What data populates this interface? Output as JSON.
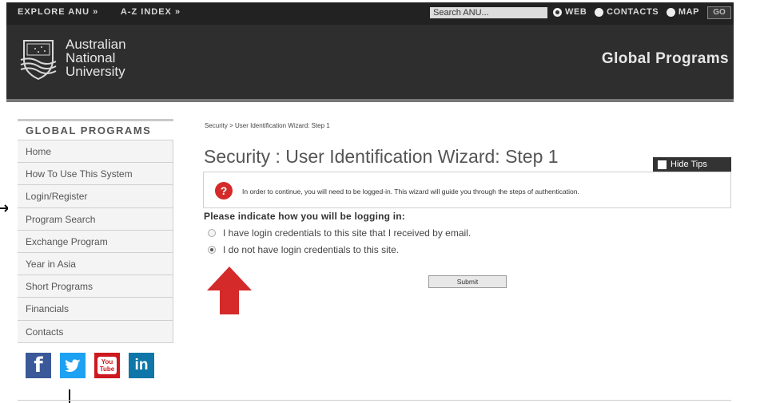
{
  "topbar": {
    "explore_label": "EXPLORE ANU »",
    "az_label": "A-Z INDEX »",
    "search_value": "Search ANU...",
    "options": [
      {
        "label": "WEB",
        "selected": true
      },
      {
        "label": "CONTACTS",
        "selected": false
      },
      {
        "label": "MAP",
        "selected": false
      }
    ],
    "go_label": "GO"
  },
  "header": {
    "logo_lines": [
      "Australian",
      "National",
      "University"
    ],
    "site_title": "Global Programs"
  },
  "sidebar": {
    "title": "GLOBAL PROGRAMS",
    "items": [
      {
        "label": "Home"
      },
      {
        "label": "How To Use This System"
      },
      {
        "label": "Login/Register"
      },
      {
        "label": "Program Search"
      },
      {
        "label": "Exchange Program"
      },
      {
        "label": "Year in Asia"
      },
      {
        "label": "Short Programs"
      },
      {
        "label": "Financials"
      },
      {
        "label": "Contacts"
      }
    ],
    "social": [
      {
        "icon": "facebook-icon",
        "glyph": "f"
      },
      {
        "icon": "twitter-icon",
        "glyph": "🐦"
      },
      {
        "icon": "youtube-icon",
        "glyph": "You\nTube"
      },
      {
        "icon": "linkedin-icon",
        "glyph": "in"
      }
    ]
  },
  "main": {
    "breadcrumb": "Security > User Identification Wizard: Step 1",
    "title": "Security : User Identification Wizard: Step 1",
    "hide_tips_label": "Hide Tips",
    "tip_text": "In order to continue, you will need to be logged-in. This wizard will guide you through the steps of authentication.",
    "prompt": "Please indicate how you will be logging in:",
    "options": [
      {
        "label": "I have login credentials to this site that I received by email.",
        "selected": false
      },
      {
        "label": "I do not have login credentials to this site.",
        "selected": true
      }
    ],
    "submit_label": "Submit"
  },
  "colors": {
    "accent_red": "#d42a2a",
    "header_bg": "#2e2e2e",
    "topbar_bg": "#222222"
  }
}
